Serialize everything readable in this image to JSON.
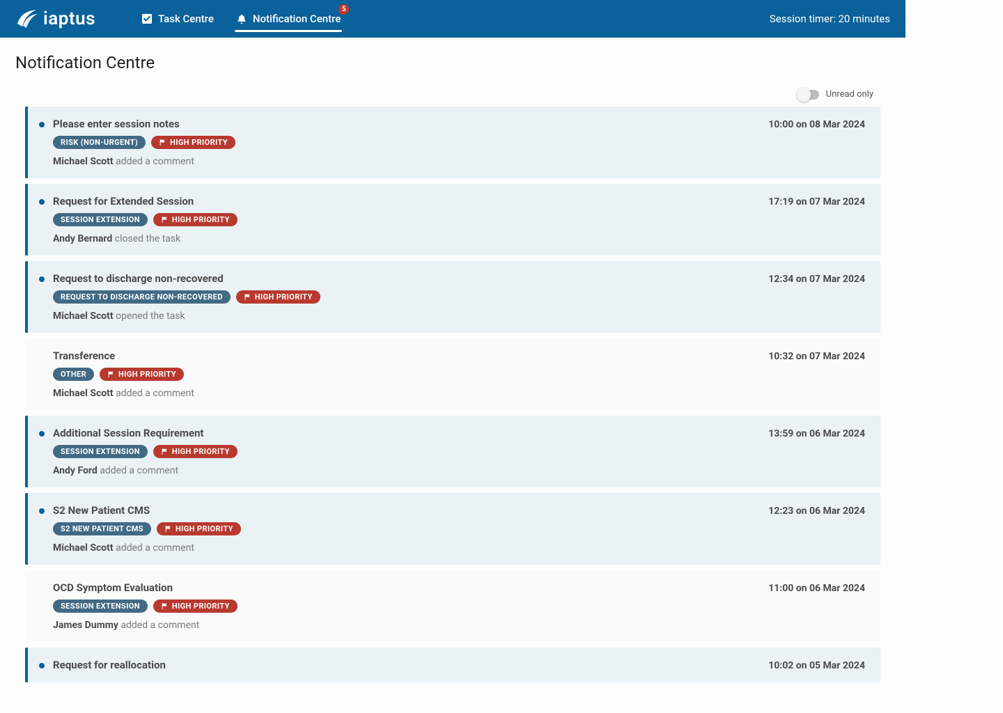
{
  "header": {
    "logo_text": "iaptus",
    "session_timer": "Session timer: 20 minutes"
  },
  "nav": {
    "task_centre": "Task Centre",
    "notification_centre": "Notification Centre",
    "notification_badge": "5"
  },
  "page": {
    "title": "Notification Centre",
    "unread_only_label": "Unread only"
  },
  "priority_label": "HIGH PRIORITY",
  "notifications": [
    {
      "title": "Please enter session notes",
      "timestamp": "10:00 on 08 Mar 2024",
      "category": "RISK (NON-URGENT)",
      "actor": "Michael Scott",
      "action": "added a comment",
      "unread": true
    },
    {
      "title": "Request for Extended Session",
      "timestamp": "17:19 on 07 Mar 2024",
      "category": "SESSION EXTENSION",
      "actor": "Andy Bernard",
      "action": "closed the task",
      "unread": true
    },
    {
      "title": "Request to discharge non-recovered",
      "timestamp": "12:34 on 07 Mar 2024",
      "category": "REQUEST TO DISCHARGE NON-RECOVERED",
      "actor": "Michael Scott",
      "action": "opened the task",
      "unread": true
    },
    {
      "title": "Transference",
      "timestamp": "10:32 on 07 Mar 2024",
      "category": "OTHER",
      "actor": "Michael Scott",
      "action": "added a comment",
      "unread": false
    },
    {
      "title": "Additional Session Requirement",
      "timestamp": "13:59 on 06 Mar 2024",
      "category": "SESSION EXTENSION",
      "actor": "Andy Ford",
      "action": "added a comment",
      "unread": true
    },
    {
      "title": "S2 New Patient CMS",
      "timestamp": "12:23 on 06 Mar 2024",
      "category": "S2 NEW PATIENT CMS",
      "actor": "Michael Scott",
      "action": "added a comment",
      "unread": true
    },
    {
      "title": "OCD Symptom Evaluation",
      "timestamp": "11:00 on 06 Mar 2024",
      "category": "SESSION EXTENSION",
      "actor": "James Dummy",
      "action": "added a comment",
      "unread": false
    },
    {
      "title": "Request for reallocation",
      "timestamp": "10:02 on 05 Mar 2024",
      "category": "",
      "actor": "",
      "action": "",
      "unread": true
    }
  ]
}
